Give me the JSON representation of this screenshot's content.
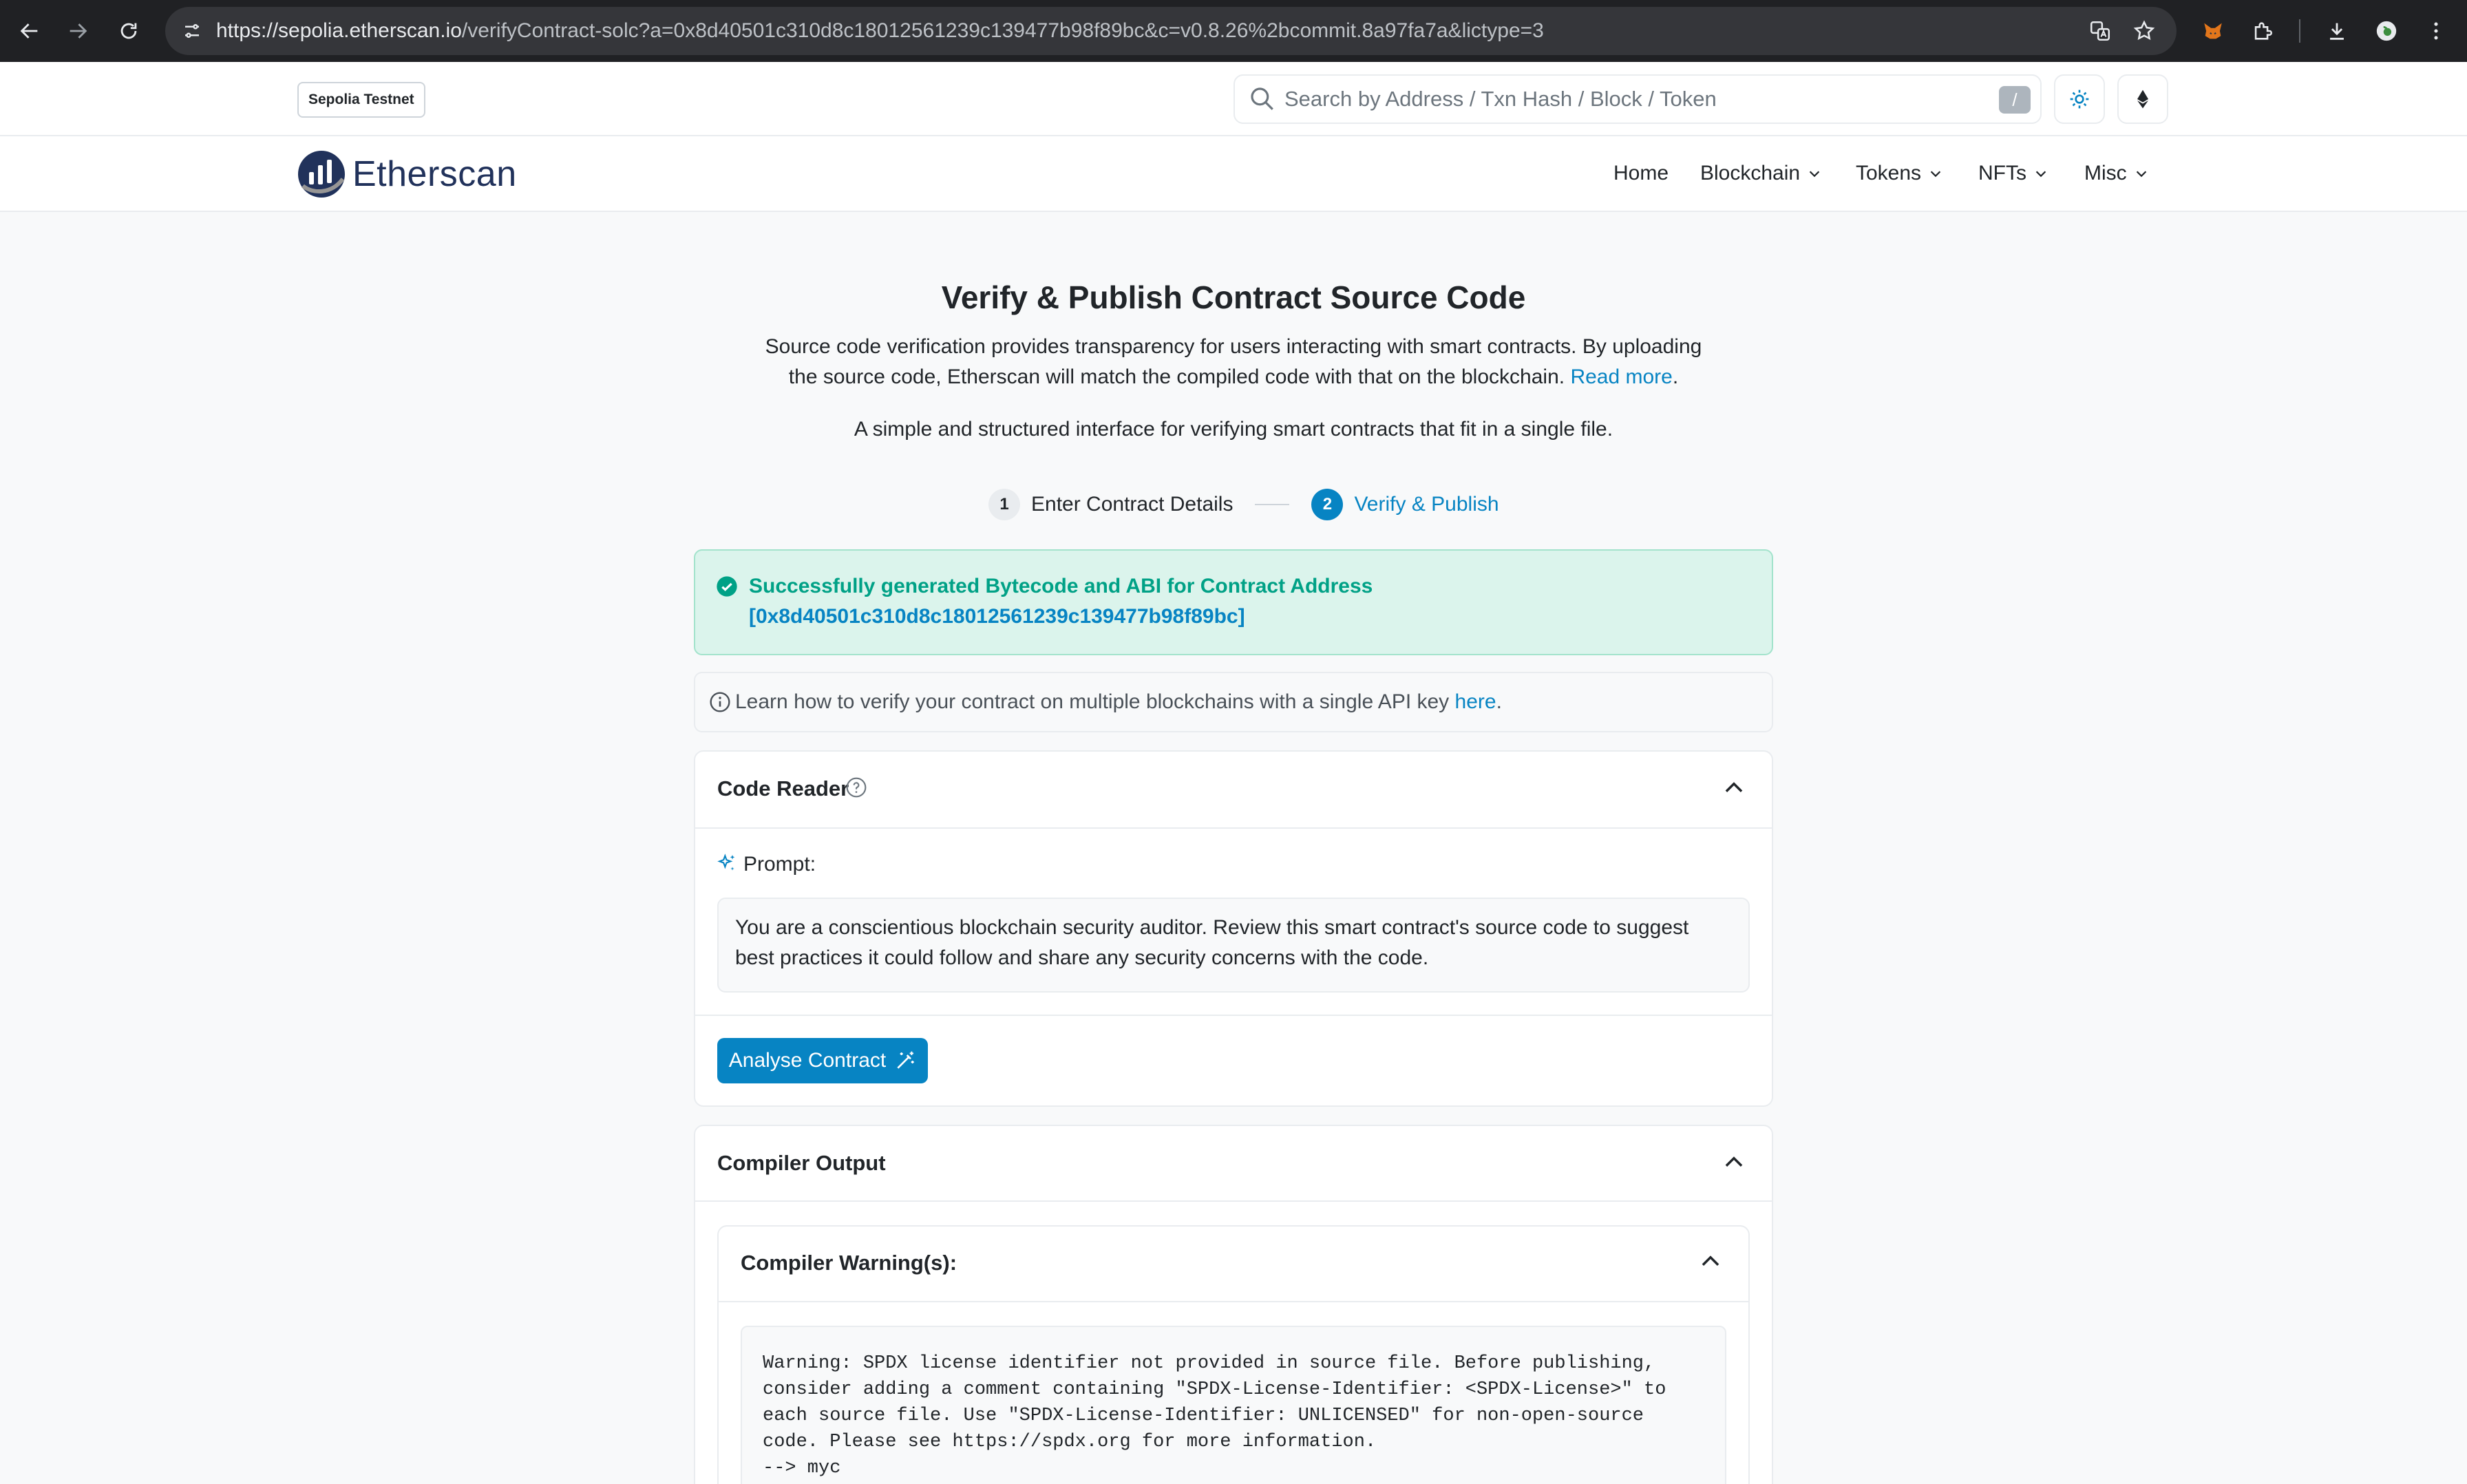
{
  "browser": {
    "url_host": "https://sepolia.etherscan.io",
    "url_path": "/verifyContract-solc?a=0x8d40501c310d8c18012561239c139477b98f89bc&c=v0.8.26%2bcommit.8a97fa7a&lictype=3"
  },
  "header": {
    "network_badge": "Sepolia Testnet",
    "search_placeholder": "Search by Address / Txn Hash / Block / Token",
    "search_shortcut": "/",
    "logo_text": "Etherscan",
    "nav": {
      "home": "Home",
      "blockchain": "Blockchain",
      "tokens": "Tokens",
      "nfts": "NFTs",
      "misc": "Misc"
    }
  },
  "main": {
    "title": "Verify & Publish Contract Source Code",
    "intro": "Source code verification provides transparency for users interacting with smart contracts. By uploading the source code, Etherscan will match the compiled code with that on the blockchain.",
    "intro_link": "Read more",
    "intro2": "A simple and structured interface for verifying smart contracts that fit in a single file.",
    "steps": [
      {
        "num": "1",
        "label": "Enter Contract Details"
      },
      {
        "num": "2",
        "label": "Verify & Publish"
      }
    ],
    "success": {
      "title": "Successfully generated Bytecode and ABI for Contract Address",
      "address": "[0x8d40501c310d8c18012561239c139477b98f89bc]"
    },
    "info": {
      "text": "Learn how to verify your contract on multiple blockchains with a single API key",
      "link": "here"
    },
    "code_reader": {
      "title": "Code Reader",
      "prompt_label": "Prompt:",
      "prompt": "You are a conscientious blockchain security auditor. Review this smart contract's source code to suggest best practices it could follow and share any security concerns with the code.",
      "button": "Analyse Contract"
    },
    "compiler_output": {
      "title": "Compiler Output",
      "warnings_title": "Compiler Warning(s):",
      "warning_text": "Warning: SPDX license identifier not provided in source file. Before publishing, consider adding a comment containing \"SPDX-License-Identifier: <SPDX-License>\" to each source file. Use \"SPDX-License-Identifier: UNLICENSED\" for non-open-source code. Please see https://spdx.org for more information.\n--> myc"
    }
  },
  "colors": {
    "primary": "#0784c3",
    "success_bg": "#dbf4ec",
    "success_text": "#00a186",
    "logo": "#21325b"
  }
}
